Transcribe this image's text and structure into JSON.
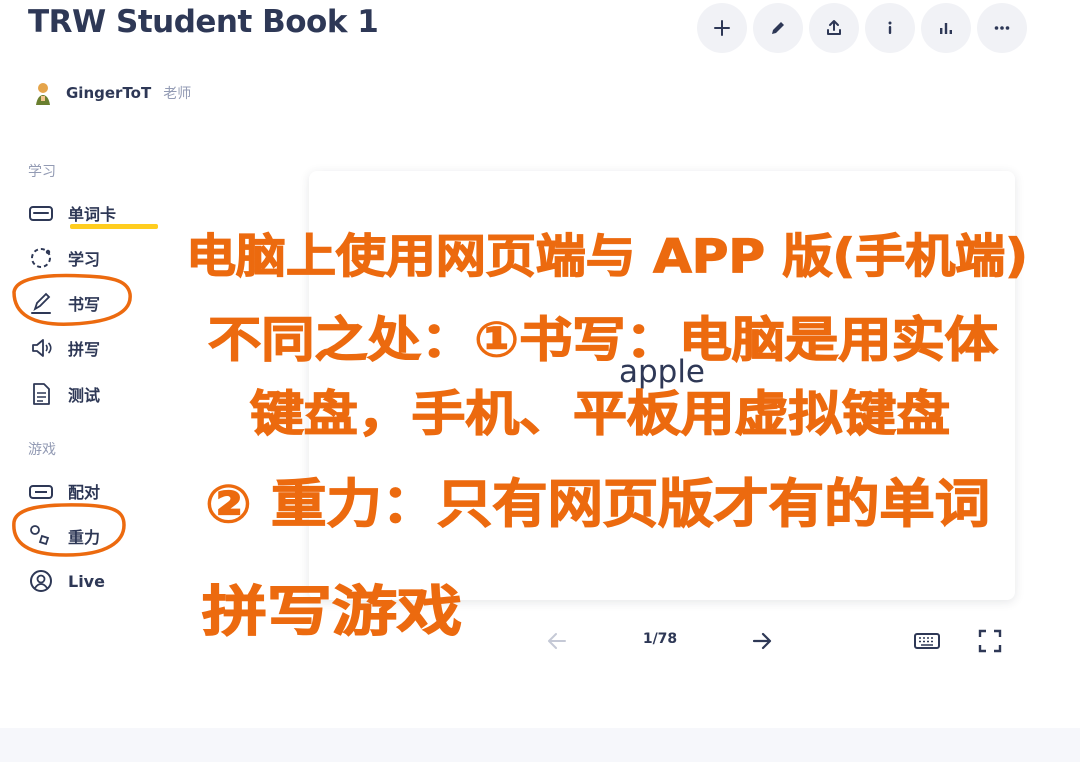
{
  "header": {
    "title": "TRW Student Book 1",
    "toolbar": [
      {
        "icon": "plus-icon",
        "name": "add-button"
      },
      {
        "icon": "pencil-icon",
        "name": "edit-button"
      },
      {
        "icon": "share-icon",
        "name": "share-button"
      },
      {
        "icon": "info-icon",
        "name": "info-button"
      },
      {
        "icon": "bar-chart-icon",
        "name": "stats-button"
      },
      {
        "icon": "more-icon",
        "name": "more-button"
      }
    ]
  },
  "author": {
    "name": "GingerToT",
    "role": "老师"
  },
  "sidebar": {
    "study_label": "学习",
    "study_items": [
      {
        "label": "单词卡",
        "icon": "flashcards-icon",
        "active": true
      },
      {
        "label": "学习",
        "icon": "learn-icon"
      },
      {
        "label": "书写",
        "icon": "write-icon"
      },
      {
        "label": "拼写",
        "icon": "spell-icon"
      },
      {
        "label": "测试",
        "icon": "test-icon"
      }
    ],
    "games_label": "游戏",
    "game_items": [
      {
        "label": "配对",
        "icon": "match-icon"
      },
      {
        "label": "重力",
        "icon": "gravity-icon"
      },
      {
        "label": "Live",
        "icon": "live-icon"
      }
    ]
  },
  "card": {
    "term": "apple"
  },
  "card_nav": {
    "counter": "1/78"
  },
  "annotation": {
    "color": "#ec6a0f",
    "lines": [
      "电脑上使用网页端与 APP 版(手机端)",
      "不同之处：①书写：电脑是用实体",
      "键盘，手机、平板用虚拟键盘",
      "② 重力：只有网页版才有的单词",
      "拼写游戏"
    ]
  },
  "colors": {
    "text": "#2e3856",
    "muted": "#939bb4",
    "accent": "#ffcd1f",
    "button_bg": "#f1f2f6"
  }
}
